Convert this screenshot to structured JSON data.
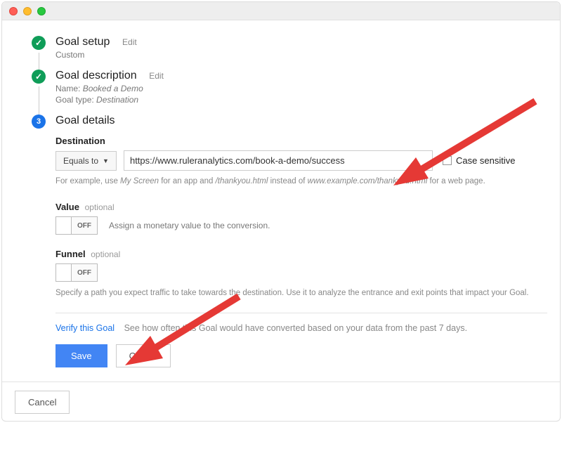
{
  "steps": {
    "setup": {
      "title": "Goal setup",
      "edit": "Edit",
      "sub": "Custom"
    },
    "description": {
      "title": "Goal description",
      "edit": "Edit",
      "name_label": "Name:",
      "name_value": "Booked a Demo",
      "type_label": "Goal type:",
      "type_value": "Destination"
    },
    "details": {
      "title": "Goal details",
      "number": "3"
    }
  },
  "destination": {
    "label": "Destination",
    "match_type": "Equals to",
    "url": "https://www.ruleranalytics.com/book-a-demo/success",
    "case_sensitive": "Case sensitive",
    "hint_prefix": "For example, use ",
    "hint_app": "My Screen",
    "hint_mid1": " for an app and ",
    "hint_path": "/thankyou.html",
    "hint_mid2": " instead of ",
    "hint_full": "www.example.com/thankyou.html",
    "hint_suffix": " for a web page."
  },
  "value": {
    "label": "Value",
    "optional": "optional",
    "toggle": "OFF",
    "desc": "Assign a monetary value to the conversion."
  },
  "funnel": {
    "label": "Funnel",
    "optional": "optional",
    "toggle": "OFF",
    "desc": "Specify a path you expect traffic to take towards the destination. Use it to analyze the entrance and exit points that impact your Goal."
  },
  "verify": {
    "link": "Verify this Goal",
    "desc": "See how often this Goal would have converted based on your data from the past 7 days."
  },
  "buttons": {
    "save": "Save",
    "cancel": "Cancel",
    "outer_cancel": "Cancel"
  }
}
